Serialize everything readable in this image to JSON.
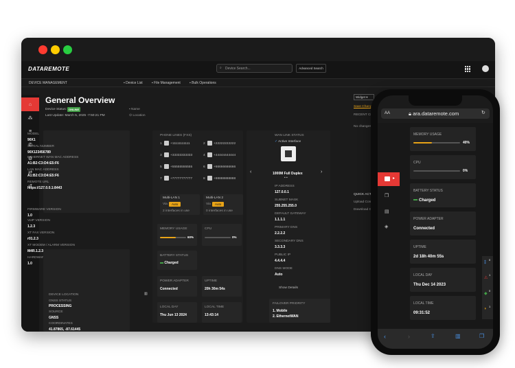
{
  "brand": {
    "logo": "DATAREMOTE",
    "accent": "#e53935",
    "online": "#43a047",
    "warn": "#e8a317"
  },
  "topnav": {
    "search_placeholder": "Device Search...",
    "advanced": "Advanced Search"
  },
  "subnav": {
    "section": "DEVICE MANAGEMENT",
    "device_list": "Device List",
    "file_mgmt": "File Management",
    "bulk": "Bulk Operations"
  },
  "page": {
    "title": "General Overview",
    "status_label": "Device Status:",
    "status": "ONLINE",
    "update": "Last Update: March 5, 2025 -7:50:21 PM",
    "name": "Name",
    "location": "Location"
  },
  "info": [
    {
      "l": "MODEL",
      "v": "90X1"
    },
    {
      "l": "SERIAL NUMBER",
      "v": "90X123456789"
    },
    {
      "l": "ETHERNET WAN MAC ADDRESS",
      "v": "A1:B2:C3:D4:E5:F6"
    },
    {
      "l": "LAN MAC ADDRESS",
      "v": "A1:B2:C3:D4:E5:F6"
    },
    {
      "l": "REMOTE URL",
      "v": "https://127.0.0.1:8443"
    },
    {
      "l": "FIRMWARE VERSION",
      "v": "1.0"
    },
    {
      "l": "VoIP VERSION",
      "v": "1.2.3"
    },
    {
      "l": "XT FAX VERSION",
      "v": "r01.2.3"
    },
    {
      "l": "XT MODEM / ALARM VERSION",
      "v": "M4R.1.2.3y"
    },
    {
      "l": "HARDWARE VERSION",
      "v": "1.0"
    }
  ],
  "location": {
    "header": "DEVICE LOCATION",
    "gnss_l": "GNSS STATUS",
    "gnss_v": "PROCESSING",
    "source_l": "SOURCE",
    "source_v": "GNSS",
    "coords_l": "COORDINATES",
    "coords_v": "41.87865, -87.61445"
  },
  "phone_lines": {
    "title": "PHONE LINES (FXS)",
    "lines": [
      {
        "n": "1",
        "num": "+11111111111"
      },
      {
        "n": "2",
        "num": "+22222222222"
      },
      {
        "n": "3",
        "num": "+33333333333"
      },
      {
        "n": "4",
        "num": "+44444444444"
      },
      {
        "n": "5",
        "num": "+55555555555"
      },
      {
        "n": "6",
        "num": "+66666666666"
      },
      {
        "n": "7",
        "num": "+77777777777"
      },
      {
        "n": "8",
        "num": "+88888888888"
      }
    ]
  },
  "multilan": [
    {
      "name": "Multi-LAN 1",
      "vlan": "Via",
      "mode": "Auto",
      "count": "2 interfaces in use"
    },
    {
      "name": "Multi-LAN 2",
      "vlan": "Via",
      "mode": "Auto",
      "count": "0 interfaces in use"
    }
  ],
  "stats": {
    "mem_l": "MEMORY USAGE",
    "mem_v": "60%",
    "mem_f": 0.6,
    "cpu_l": "CPU",
    "cpu_v": "0%",
    "cpu_f": 0,
    "bat_l": "BATTERY STATUS",
    "bat_v": "Charged",
    "pa_l": "POWER ADAPTER",
    "pa_v": "Connected",
    "up_l": "UPTIME",
    "up_v": "20h 30m 54s",
    "lday_l": "LOCAL DAY",
    "lday_v": "Thu Jun 13 2024",
    "ltime_l": "LOCAL TIME",
    "ltime_v": "13:43:14"
  },
  "wan": {
    "title": "WAN LINK STATUS",
    "active": "Active Interface",
    "speed": "1000M Full Duplex",
    "fields": [
      {
        "l": "IP ADDRESS",
        "v": "127.0.0.1"
      },
      {
        "l": "SUBNET MASK",
        "v": "255.255.255.0"
      },
      {
        "l": "DEFAULT GATEWAY",
        "v": "1.1.1.1"
      },
      {
        "l": "PRIMARY DNS",
        "v": "2.2.2.2"
      },
      {
        "l": "SECONDARY DNS",
        "v": "3.3.3.3"
      },
      {
        "l": "PUBLIC IP",
        "v": "4.4.4.4"
      },
      {
        "l": "DNS MODE",
        "v": "Auto"
      }
    ],
    "show_details": "Show Details",
    "failover_title": "FAILOVER PRIORITY",
    "failover": [
      "1. Mobile",
      "2. EthernetWAN"
    ]
  },
  "right": {
    "widget": "Widget",
    "save": "Save Changes",
    "recent": "RECENT CHANGES",
    "no_changes": "No changes found",
    "quick": "QUICK ACTIONS",
    "upload": "Upload Config",
    "download": "Download Config"
  },
  "mobile": {
    "aa": "AA",
    "url": "ara.dataremote.com",
    "cards": [
      {
        "l": "MEMORY USAGE",
        "v": "40%",
        "f": 0.4
      },
      {
        "l": "CPU",
        "v": "0%",
        "f": 0
      },
      {
        "l": "BATTERY STATUS",
        "v": "Charged"
      },
      {
        "l": "POWER ADAPTER",
        "v": "Connected"
      },
      {
        "l": "UPTIME",
        "v": "2d 18h 40m 55s"
      },
      {
        "l": "LOCAL DAY",
        "v": "Thu Dec 14 2023"
      },
      {
        "l": "LOCAL TIME",
        "v": "09:31:52"
      }
    ],
    "side_badges": [
      "0",
      "1",
      "0",
      "1"
    ]
  }
}
